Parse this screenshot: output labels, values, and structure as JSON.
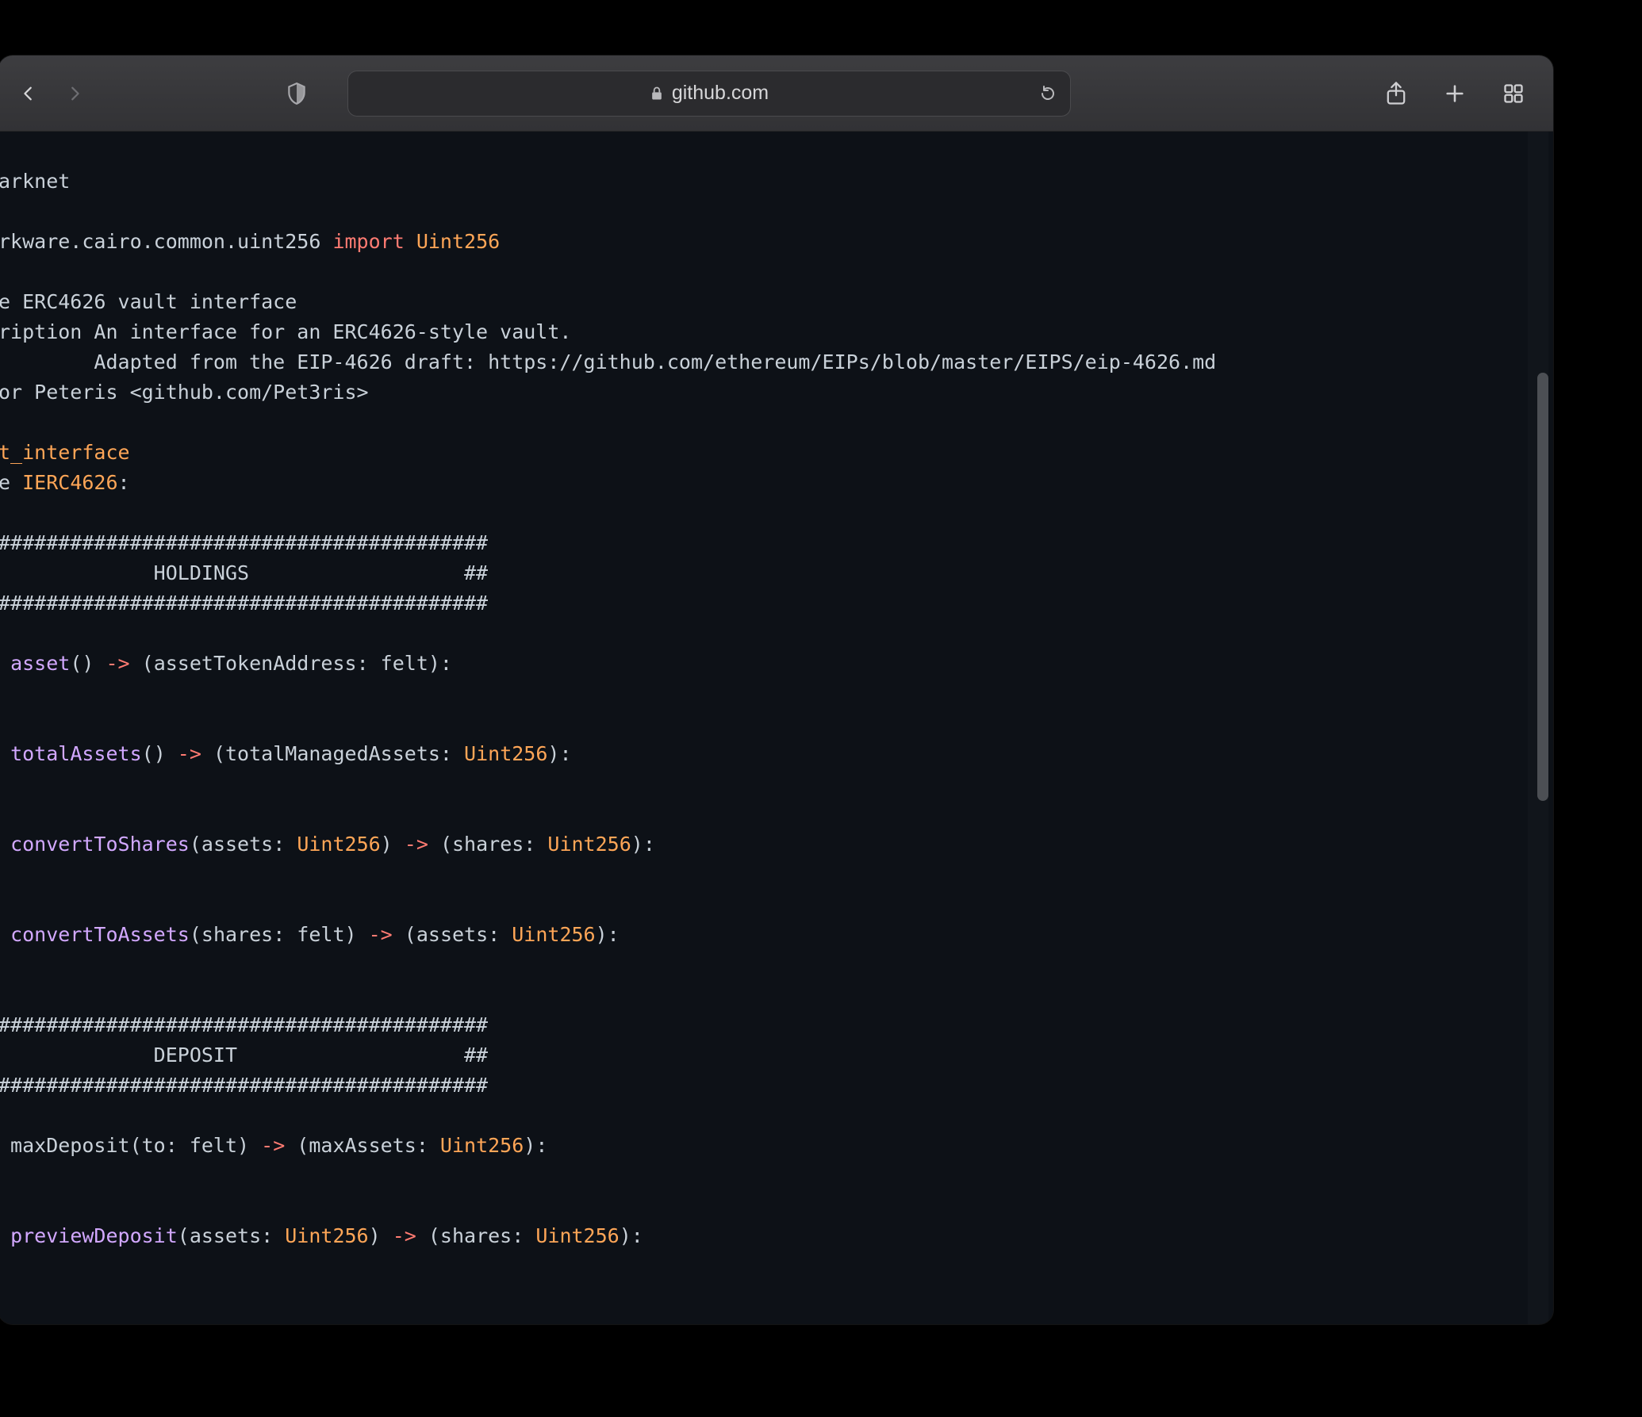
{
  "toolbar": {
    "address": "github.com"
  },
  "code_tokens": [
    [
      {
        "t": "arknet",
        "c": "plain"
      }
    ],
    [],
    [
      {
        "t": "rkware.cairo.common.uint256 ",
        "c": "plain"
      },
      {
        "t": "import",
        "c": "kw"
      },
      {
        "t": " ",
        "c": "plain"
      },
      {
        "t": "Uint256",
        "c": "type"
      }
    ],
    [],
    [
      {
        "t": "e ERC4626 vault interface",
        "c": "plain"
      }
    ],
    [
      {
        "t": "ription An interface for an ERC4626-style vault.",
        "c": "plain"
      }
    ],
    [
      {
        "t": "        Adapted from the EIP-4626 draft: https://github.com/ethereum/EIPs/blob/master/EIPS/eip-4626.md",
        "c": "plain"
      }
    ],
    [
      {
        "t": "or Peteris <github.com/Pet3ris>",
        "c": "plain"
      }
    ],
    [],
    [
      {
        "t": "t_interface",
        "c": "type"
      }
    ],
    [
      {
        "t": "e ",
        "c": "plain"
      },
      {
        "t": "IERC4626",
        "c": "type"
      },
      {
        "t": ":",
        "c": "plain"
      }
    ],
    [],
    [
      {
        "t": "#########################################",
        "c": "plain"
      }
    ],
    [
      {
        "t": "             HOLDINGS                  ##",
        "c": "plain"
      }
    ],
    [
      {
        "t": "#########################################",
        "c": "plain"
      }
    ],
    [],
    [
      {
        "t": " ",
        "c": "plain"
      },
      {
        "t": "asset",
        "c": "fn"
      },
      {
        "t": "() ",
        "c": "plain"
      },
      {
        "t": "->",
        "c": "op"
      },
      {
        "t": " (assetTokenAddress: felt):",
        "c": "plain"
      }
    ],
    [],
    [],
    [
      {
        "t": " ",
        "c": "plain"
      },
      {
        "t": "totalAssets",
        "c": "fn"
      },
      {
        "t": "() ",
        "c": "plain"
      },
      {
        "t": "->",
        "c": "op"
      },
      {
        "t": " (totalManagedAssets: ",
        "c": "plain"
      },
      {
        "t": "Uint256",
        "c": "type"
      },
      {
        "t": "):",
        "c": "plain"
      }
    ],
    [],
    [],
    [
      {
        "t": " ",
        "c": "plain"
      },
      {
        "t": "convertToShares",
        "c": "fn"
      },
      {
        "t": "(assets: ",
        "c": "plain"
      },
      {
        "t": "Uint256",
        "c": "type"
      },
      {
        "t": ") ",
        "c": "plain"
      },
      {
        "t": "->",
        "c": "op"
      },
      {
        "t": " (shares: ",
        "c": "plain"
      },
      {
        "t": "Uint256",
        "c": "type"
      },
      {
        "t": "):",
        "c": "plain"
      }
    ],
    [],
    [],
    [
      {
        "t": " ",
        "c": "plain"
      },
      {
        "t": "convertToAssets",
        "c": "fn"
      },
      {
        "t": "(shares: felt) ",
        "c": "plain"
      },
      {
        "t": "->",
        "c": "op"
      },
      {
        "t": " (assets: ",
        "c": "plain"
      },
      {
        "t": "Uint256",
        "c": "type"
      },
      {
        "t": "):",
        "c": "plain"
      }
    ],
    [],
    [],
    [
      {
        "t": "#########################################",
        "c": "plain"
      }
    ],
    [
      {
        "t": "             DEPOSIT                   ##",
        "c": "plain"
      }
    ],
    [
      {
        "t": "#########################################",
        "c": "plain"
      }
    ],
    [],
    [
      {
        "t": " maxDeposit(to: felt) ",
        "c": "plain"
      },
      {
        "t": "->",
        "c": "op"
      },
      {
        "t": " (maxAssets: ",
        "c": "plain"
      },
      {
        "t": "Uint256",
        "c": "type"
      },
      {
        "t": "):",
        "c": "plain"
      }
    ],
    [],
    [],
    [
      {
        "t": " ",
        "c": "plain"
      },
      {
        "t": "previewDeposit",
        "c": "fn"
      },
      {
        "t": "(assets: ",
        "c": "plain"
      },
      {
        "t": "Uint256",
        "c": "type"
      },
      {
        "t": ") ",
        "c": "plain"
      },
      {
        "t": "->",
        "c": "op"
      },
      {
        "t": " (shares: ",
        "c": "plain"
      },
      {
        "t": "Uint256",
        "c": "type"
      },
      {
        "t": "):",
        "c": "plain"
      }
    ],
    [],
    []
  ]
}
